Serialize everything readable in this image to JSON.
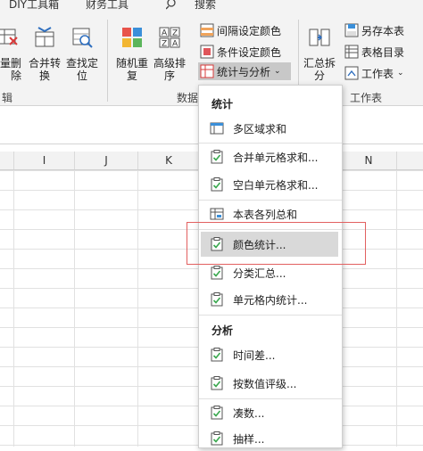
{
  "tabs": {
    "diy": "DIY工具箱",
    "finance": "财务工具",
    "search": "搜索"
  },
  "ribbon": {
    "tools": [
      {
        "id": "delete",
        "label": "量删\n除"
      },
      {
        "id": "merge",
        "label": "合并转\n换"
      },
      {
        "id": "findlocate",
        "label": "查找定\n位"
      },
      {
        "id": "random",
        "label": "随机重\n复"
      },
      {
        "id": "sort",
        "label": "高级排\n序"
      },
      {
        "id": "summary",
        "label": "汇总拆\n分"
      }
    ],
    "small_tools": {
      "interval_color": "间隔设定颜色",
      "condition_color": "条件设定颜色",
      "stats": "统计与分析",
      "save_table": "另存本表",
      "table_dir": "表格目录",
      "worksheet": "工作表"
    },
    "groups": {
      "edit": "辑",
      "data": "数据",
      "worksheet": "工作表"
    }
  },
  "columns": [
    "I",
    "J",
    "K",
    "N"
  ],
  "menu": {
    "section_stats": "统计",
    "section_analysis": "分析",
    "items": [
      {
        "label": "多区域求和",
        "icon": "multi-area-sum-icon"
      },
      {
        "label": "合并单元格求和...",
        "icon": "clipboard-check-icon"
      },
      {
        "label": "空白单元格求和...",
        "icon": "clipboard-check-icon"
      },
      {
        "label": "本表各列总和",
        "icon": "table-sum-icon"
      },
      {
        "label": "颜色统计...",
        "icon": "clipboard-check-icon"
      },
      {
        "label": "分类汇总...",
        "icon": "clipboard-check-icon"
      },
      {
        "label": "单元格内统计...",
        "icon": "clipboard-check-icon"
      }
    ],
    "analysis_items": [
      {
        "label": "时间差...",
        "icon": "clipboard-check-icon"
      },
      {
        "label": "按数值评级...",
        "icon": "clipboard-check-icon"
      },
      {
        "label": "凑数...",
        "icon": "clipboard-check-icon"
      },
      {
        "label": "抽样...",
        "icon": "clipboard-check-icon"
      }
    ]
  }
}
